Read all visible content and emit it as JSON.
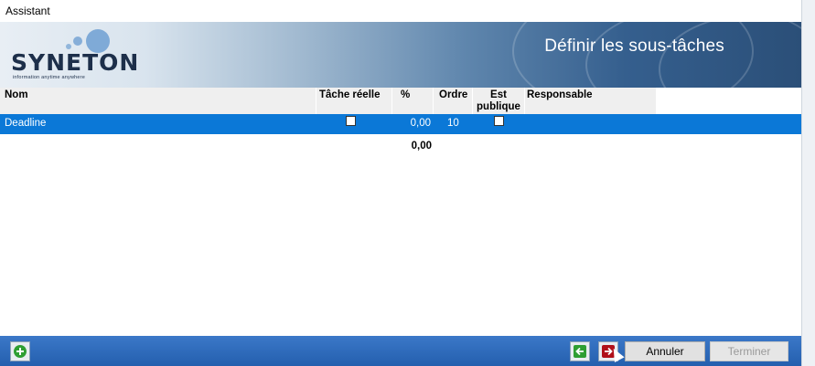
{
  "window": {
    "title": "Assistant"
  },
  "banner": {
    "logo_text": "SYNETON",
    "logo_tagline": "information anytime anywhere",
    "heading": "Définir les sous-tâches"
  },
  "grid": {
    "columns": [
      "Nom",
      "Tâche réelle",
      "%",
      "Ordre",
      "Est publique",
      "Responsable"
    ],
    "rows": [
      {
        "nom": "Deadline",
        "tache_reelle": false,
        "pourcent": "0,00",
        "ordre": "10",
        "est_publique": false,
        "responsable": ""
      }
    ],
    "total_pourcent": "0,00"
  },
  "footer": {
    "add_icon": "add-circle-icon",
    "back_icon": "arrow-left-icon",
    "next_icon": "arrow-right-icon",
    "cancel_label": "Annuler",
    "finish_label": "Terminer"
  },
  "colors": {
    "selection": "#0b78d7",
    "footer": "#2d6bbd",
    "add_green": "#2e9e32",
    "back_green": "#2e9e32",
    "next_red": "#b0101a"
  }
}
